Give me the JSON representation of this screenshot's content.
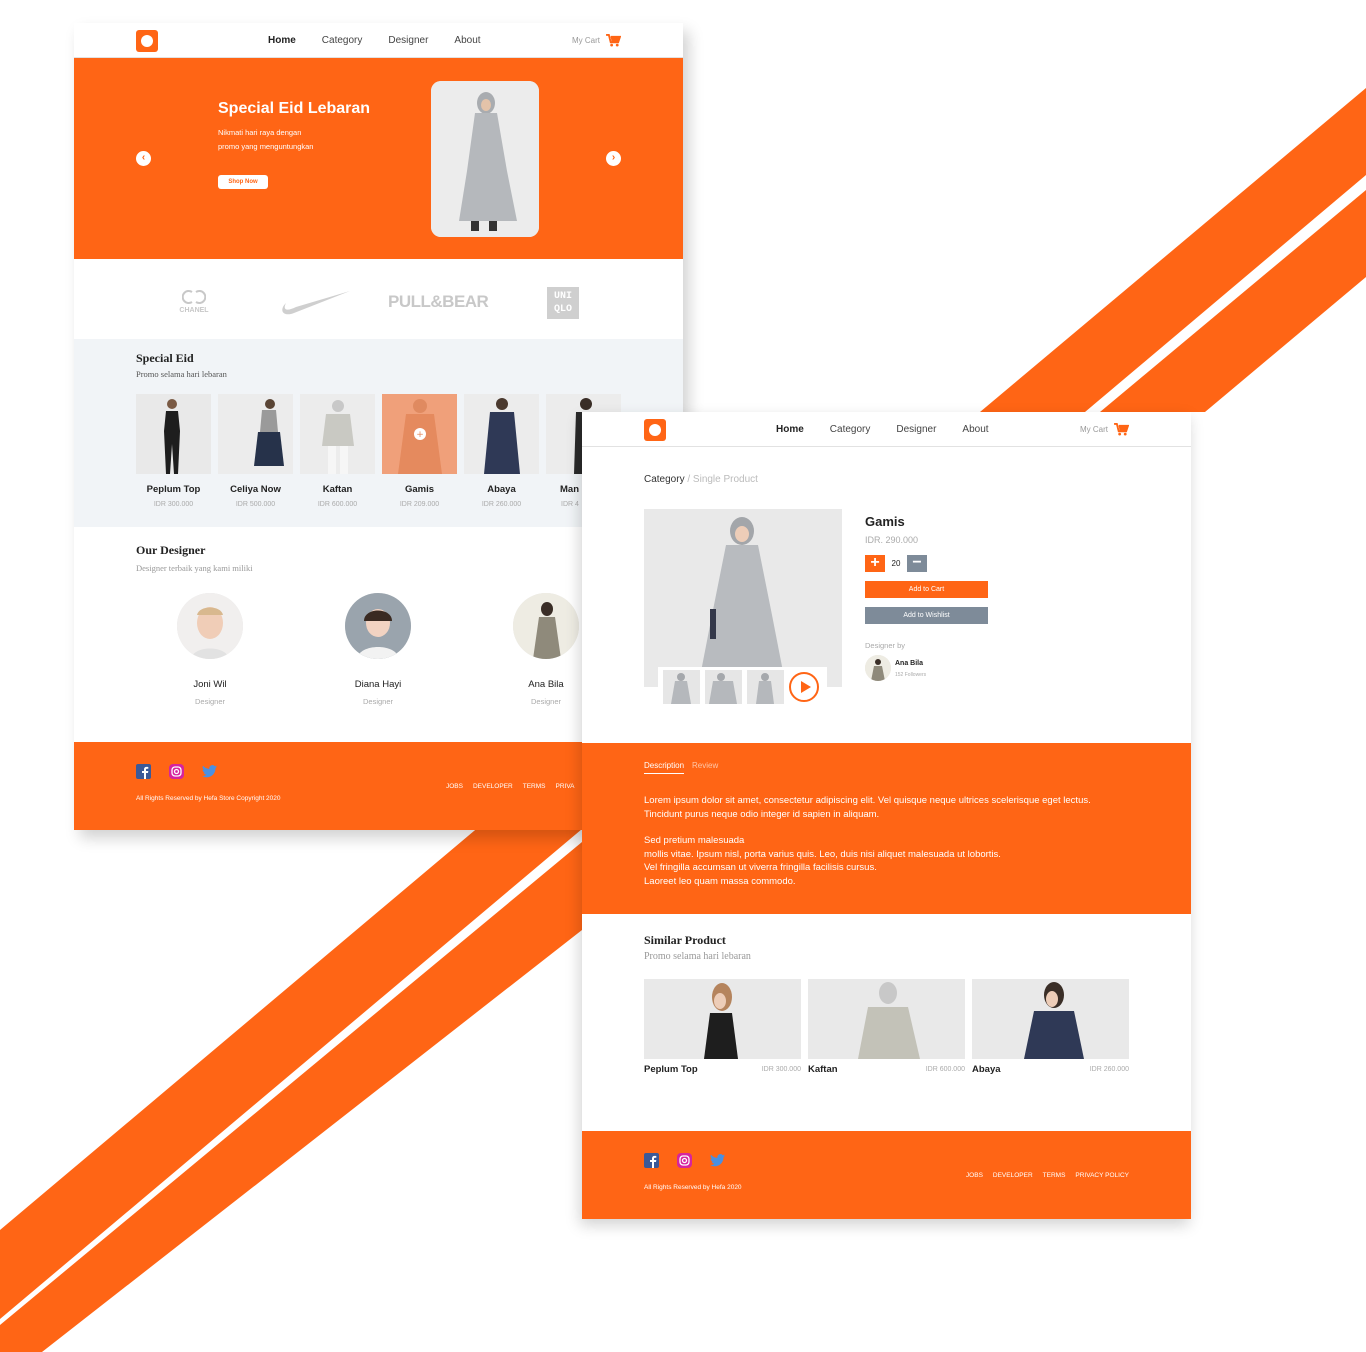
{
  "colors": {
    "accent": "#ff6515",
    "gray_button": "#7e8b99",
    "section_bg": "#f1f4f7"
  },
  "nav": {
    "links": [
      "Home",
      "Category",
      "Designer",
      "About"
    ],
    "cart_label": "My Cart"
  },
  "home_page": {
    "hero": {
      "title": "Special Eid Lebaran",
      "subtitle_line1": "Nikmati hari raya dengan",
      "subtitle_line2": "promo yang menguntungkan",
      "button": "Shop Now"
    },
    "brands": [
      "CHANEL",
      "PULL&BEAR",
      "UNI QLO"
    ],
    "special": {
      "title": "Special Eid",
      "subtitle": "Promo selama hari lebaran",
      "products": [
        {
          "name": "Peplum Top",
          "price": "IDR 300.000"
        },
        {
          "name": "Celiya Now",
          "price": "IDR 500.000"
        },
        {
          "name": "Kaftan",
          "price": "IDR 600.000"
        },
        {
          "name": "Gamis",
          "price": "IDR 209.000"
        },
        {
          "name": "Abaya",
          "price": "IDR 260.000"
        },
        {
          "name": "Man",
          "price": "IDR 4"
        }
      ]
    },
    "designers": {
      "title": "Our Designer",
      "subtitle": "Designer terbaik yang kami miliki",
      "items": [
        {
          "name": "Joni Wil",
          "role": "Designer"
        },
        {
          "name": "Diana Hayi",
          "role": "Designer"
        },
        {
          "name": "Ana Bila",
          "role": "Designer"
        }
      ]
    },
    "footer": {
      "copyright": "All Rights Reserved by Hefa Store Copyright 2020",
      "links": [
        "JOBS",
        "DEVELOPER",
        "TERMS",
        "PRIVA"
      ]
    }
  },
  "product_page": {
    "breadcrumb": {
      "root": "Category",
      "separator": " / ",
      "current": "Single Product"
    },
    "product": {
      "name": "Gamis",
      "price": "IDR. 290.000",
      "quantity": "20",
      "add_to_cart": "Add to Cart",
      "add_to_wishlist": "Add to Wishlist",
      "designer_by": "Designer by",
      "designer_name": "Ana Bila",
      "designer_followers": "152 Followers"
    },
    "tabs": [
      "Description",
      "Review"
    ],
    "description": {
      "p1": "Lorem ipsum dolor sit amet, consectetur adipiscing elit. Vel quisque neque ultrices scelerisque eget lectus. Tincidunt purus neque odio integer id sapien in aliquam.",
      "p2_l1": "Sed pretium malesuada",
      "p2_l2": "mollis vitae. Ipsum nisl, porta varius quis. Leo, duis nisi aliquet malesuada ut lobortis.",
      "p2_l3": "Vel fringilla accumsan ut viverra fringilla facilisis cursus.",
      "p2_l4": "Laoreet leo quam massa commodo."
    },
    "similar": {
      "title": "Similar Product",
      "subtitle": "Promo selama hari lebaran",
      "items": [
        {
          "name": "Peplum Top",
          "price": "IDR 300.000"
        },
        {
          "name": "Kaftan",
          "price": "IDR 600.000"
        },
        {
          "name": "Abaya",
          "price": "IDR 260.000"
        }
      ]
    },
    "footer": {
      "copyright": "All Rights Reserved by Hefa 2020",
      "links": [
        "JOBS",
        "DEVELOPER",
        "TERMS",
        "PRIVACY POLICY"
      ]
    }
  }
}
